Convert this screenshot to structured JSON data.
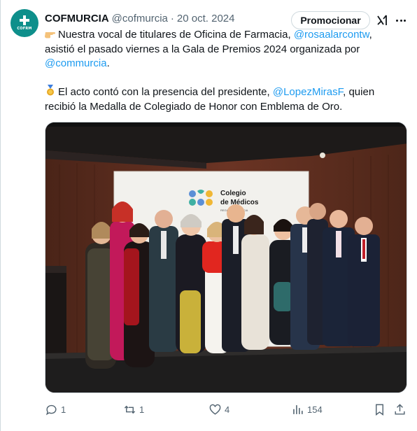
{
  "post": {
    "author_name": "COFMURCIA",
    "author_handle": "@cofmurcia",
    "separator": "·",
    "date": "20 oct. 2024",
    "promote_label": "Promocionar",
    "avatar_text": "COFRM",
    "text": {
      "l1_a": "Nuestra vocal de titulares de Oficina de Farmacia, ",
      "l1_mention": "@rosaalarcontw",
      "l1_b": ",",
      "l2": "asistió el pasado viernes a la Gala de Premios 2024 organizada por",
      "l3_mention": "@commurcia",
      "l3_b": ".",
      "l4_a": "El acto contó con la presencia del presidente, ",
      "l4_mention": "@LopezMirasF",
      "l4_b": ", quien",
      "l5": "recibió la Medalla de Colegiado de Honor con Emblema de Oro."
    },
    "emoji_1": "backhand-index-pointing-right",
    "emoji_2": "medal",
    "banner": {
      "line1": "Colegio",
      "line2": "de Médicos",
      "line3": "REGIÓN DE MURCIA"
    }
  },
  "actions": {
    "replies": "1",
    "reposts": "1",
    "likes": "4",
    "views": "154"
  },
  "colors": {
    "accent": "#1d9bf0",
    "muted": "#536471",
    "text": "#0f1419",
    "avatar_bg": "#0e8f8b"
  }
}
